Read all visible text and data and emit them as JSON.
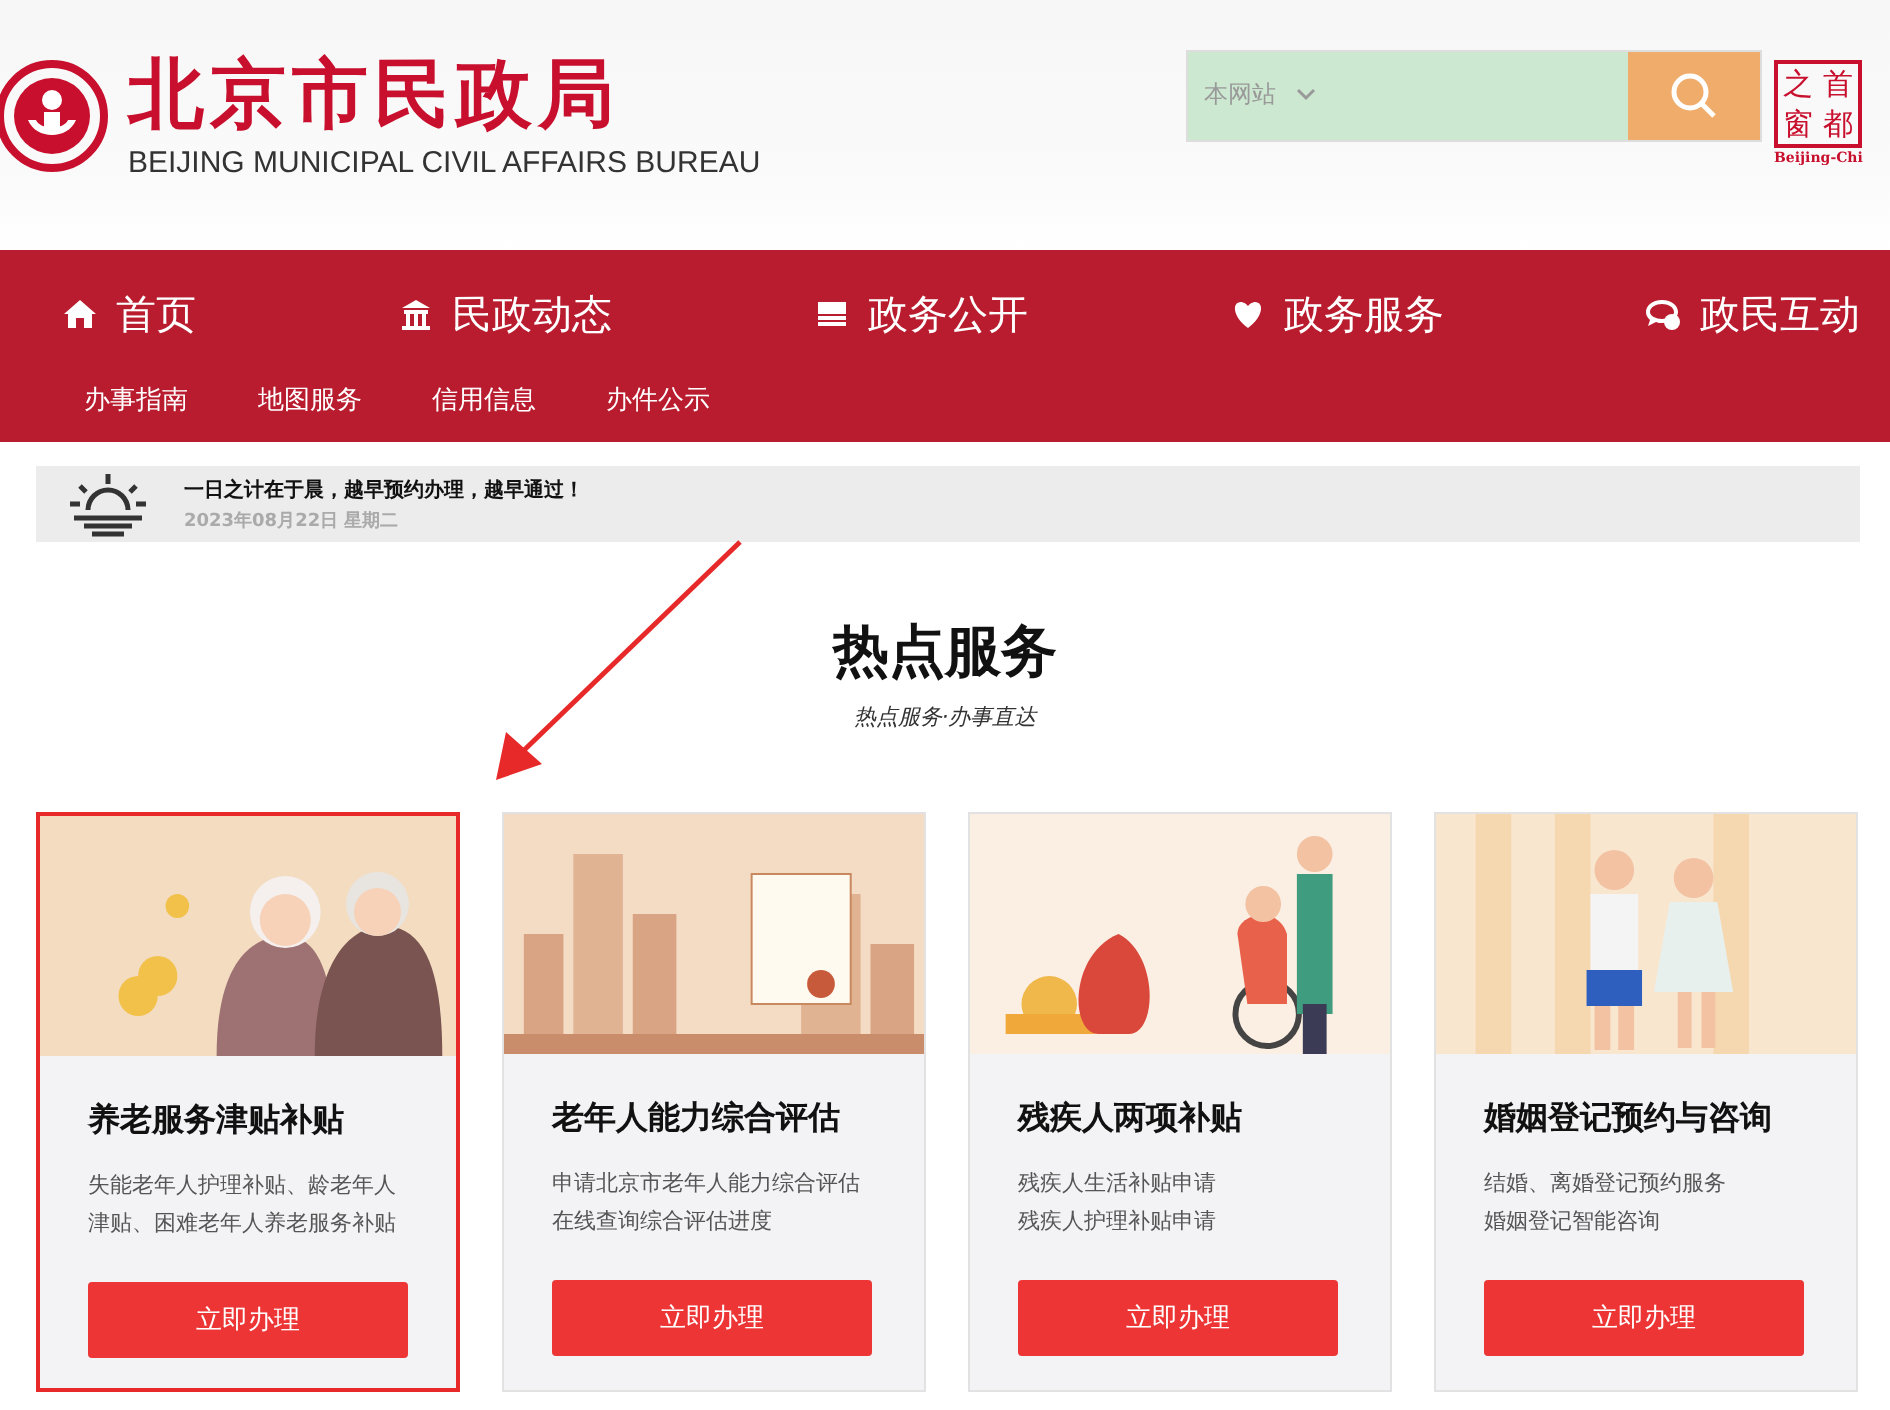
{
  "header": {
    "logo_title": "北京市民政局",
    "logo_subtitle": "BEIJING MUNICIPAL CIVIL AFFAIRS BUREAU",
    "search": {
      "scope": "本网站"
    },
    "seal": {
      "chars": [
        "之",
        "首",
        "窗",
        "都"
      ],
      "caption": "Beijing-Chi"
    }
  },
  "main_nav": [
    {
      "label": "首页",
      "kind": "home"
    },
    {
      "label": "民政动态",
      "kind": "building"
    },
    {
      "label": "政务公开",
      "kind": "stack"
    },
    {
      "label": "政务服务",
      "kind": "heart"
    },
    {
      "label": "政民互动",
      "kind": "chat"
    }
  ],
  "sub_nav": [
    "办事指南",
    "地图服务",
    "信用信息",
    "办件公示"
  ],
  "notice": {
    "message": "一日之计在于晨，越早预约办理，越早通过！",
    "date": "2023年08月22日 星期二"
  },
  "section": {
    "title": "热点服务",
    "subtitle": "热点服务·办事直达"
  },
  "cards": [
    {
      "title": "养老服务津贴补贴",
      "lines": [
        "失能老年人护理补贴、龄老年人",
        "津贴、困难老年人养老服务补贴"
      ],
      "button": "立即办理",
      "selected": true,
      "kind": "elderly"
    },
    {
      "title": "老年人能力综合评估",
      "lines": [
        "申请北京市老年人能力综合评估",
        "在线查询综合评估进度"
      ],
      "button": "立即办理",
      "selected": false,
      "kind": "city"
    },
    {
      "title": "残疾人两项补贴",
      "lines": [
        "残疾人生活补贴申请",
        "残疾人护理补贴申请"
      ],
      "button": "立即办理",
      "selected": false,
      "kind": "disability"
    },
    {
      "title": "婚姻登记预约与咨询",
      "lines": [
        "结婚、离婚登记预约服务",
        "婚姻登记智能咨询"
      ],
      "button": "立即办理",
      "selected": false,
      "kind": "couple"
    }
  ]
}
